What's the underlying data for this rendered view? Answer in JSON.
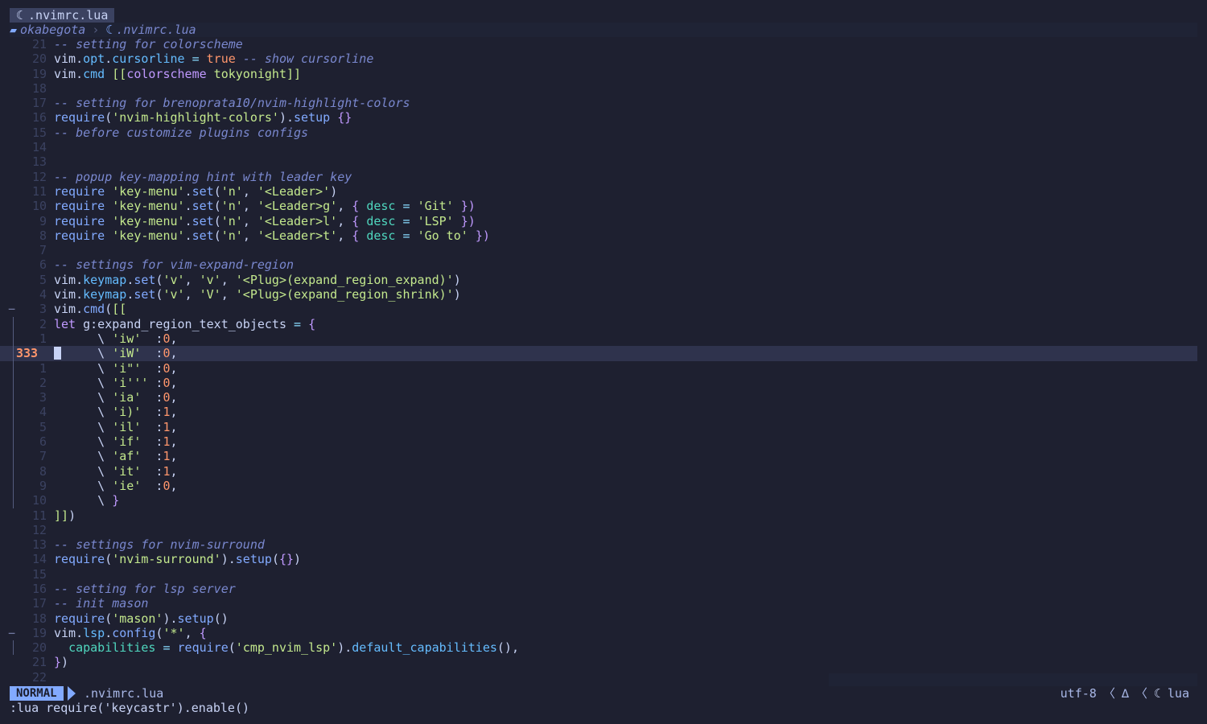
{
  "tab": {
    "icon": "lua-moon-icon",
    "title": ".nvimrc.lua"
  },
  "winbar": {
    "folder": "okabegota",
    "separator": "›",
    "file": ".nvimrc.lua"
  },
  "lines": [
    {
      "num": "21",
      "fold": "",
      "segs": [
        [
          "c",
          "-- setting for colorscheme"
        ]
      ]
    },
    {
      "num": "20",
      "fold": "",
      "segs": [
        [
          "v",
          "vim"
        ],
        [
          "v",
          "."
        ],
        [
          "p",
          "opt"
        ],
        [
          "v",
          "."
        ],
        [
          "p",
          "cursorline"
        ],
        [
          "v",
          " "
        ],
        [
          "o",
          "="
        ],
        [
          "v",
          " "
        ],
        [
          "b",
          "true"
        ],
        [
          "v",
          " "
        ],
        [
          "c",
          "-- show cursorline"
        ]
      ]
    },
    {
      "num": "19",
      "fold": "",
      "segs": [
        [
          "v",
          "vim"
        ],
        [
          "v",
          "."
        ],
        [
          "p",
          "cmd"
        ],
        [
          "v",
          " "
        ],
        [
          "s",
          "[["
        ],
        [
          "k",
          "colorscheme"
        ],
        [
          "s",
          " tokyonight]]"
        ]
      ]
    },
    {
      "num": "18",
      "fold": "",
      "segs": []
    },
    {
      "num": "17",
      "fold": "",
      "segs": [
        [
          "c",
          "-- setting for brenoprata10/nvim-highlight-colors"
        ]
      ]
    },
    {
      "num": "16",
      "fold": "",
      "segs": [
        [
          "f",
          "require"
        ],
        [
          "v",
          "("
        ],
        [
          "s",
          "'nvim-highlight-colors'"
        ],
        [
          "v",
          ")."
        ],
        [
          "f",
          "setup"
        ],
        [
          "v",
          " "
        ],
        [
          "k",
          "{}"
        ]
      ]
    },
    {
      "num": "15",
      "fold": "",
      "segs": [
        [
          "c",
          "-- before customize plugins configs"
        ]
      ]
    },
    {
      "num": "14",
      "fold": "",
      "segs": []
    },
    {
      "num": "13",
      "fold": "",
      "segs": []
    },
    {
      "num": "12",
      "fold": "",
      "segs": [
        [
          "c",
          "-- popup key-mapping hint with leader key"
        ]
      ]
    },
    {
      "num": "11",
      "fold": "",
      "segs": [
        [
          "f",
          "require"
        ],
        [
          "v",
          " "
        ],
        [
          "s",
          "'key-menu'"
        ],
        [
          "v",
          "."
        ],
        [
          "f",
          "set"
        ],
        [
          "v",
          "("
        ],
        [
          "s",
          "'n'"
        ],
        [
          "v",
          ", "
        ],
        [
          "s",
          "'<Leader>'"
        ],
        [
          "v",
          ")"
        ]
      ]
    },
    {
      "num": "10",
      "fold": "",
      "segs": [
        [
          "f",
          "require"
        ],
        [
          "v",
          " "
        ],
        [
          "s",
          "'key-menu'"
        ],
        [
          "v",
          "."
        ],
        [
          "f",
          "set"
        ],
        [
          "v",
          "("
        ],
        [
          "s",
          "'n'"
        ],
        [
          "v",
          ", "
        ],
        [
          "s",
          "'<Leader>g'"
        ],
        [
          "v",
          ", "
        ],
        [
          "k",
          "{"
        ],
        [
          "v",
          " "
        ],
        [
          "t",
          "desc"
        ],
        [
          "v",
          " "
        ],
        [
          "o",
          "="
        ],
        [
          "v",
          " "
        ],
        [
          "s",
          "'Git'"
        ],
        [
          "v",
          " "
        ],
        [
          "k",
          "})"
        ]
      ]
    },
    {
      "num": "9",
      "fold": "",
      "segs": [
        [
          "f",
          "require"
        ],
        [
          "v",
          " "
        ],
        [
          "s",
          "'key-menu'"
        ],
        [
          "v",
          "."
        ],
        [
          "f",
          "set"
        ],
        [
          "v",
          "("
        ],
        [
          "s",
          "'n'"
        ],
        [
          "v",
          ", "
        ],
        [
          "s",
          "'<Leader>l'"
        ],
        [
          "v",
          ", "
        ],
        [
          "k",
          "{"
        ],
        [
          "v",
          " "
        ],
        [
          "t",
          "desc"
        ],
        [
          "v",
          " "
        ],
        [
          "o",
          "="
        ],
        [
          "v",
          " "
        ],
        [
          "s",
          "'LSP'"
        ],
        [
          "v",
          " "
        ],
        [
          "k",
          "})"
        ]
      ]
    },
    {
      "num": "8",
      "fold": "",
      "segs": [
        [
          "f",
          "require"
        ],
        [
          "v",
          " "
        ],
        [
          "s",
          "'key-menu'"
        ],
        [
          "v",
          "."
        ],
        [
          "f",
          "set"
        ],
        [
          "v",
          "("
        ],
        [
          "s",
          "'n'"
        ],
        [
          "v",
          ", "
        ],
        [
          "s",
          "'<Leader>t'"
        ],
        [
          "v",
          ", "
        ],
        [
          "k",
          "{"
        ],
        [
          "v",
          " "
        ],
        [
          "t",
          "desc"
        ],
        [
          "v",
          " "
        ],
        [
          "o",
          "="
        ],
        [
          "v",
          " "
        ],
        [
          "s",
          "'Go to'"
        ],
        [
          "v",
          " "
        ],
        [
          "k",
          "})"
        ]
      ]
    },
    {
      "num": "7",
      "fold": "",
      "segs": []
    },
    {
      "num": "6",
      "fold": "",
      "segs": [
        [
          "c",
          "-- settings for vim-expand-region"
        ]
      ]
    },
    {
      "num": "5",
      "fold": "",
      "segs": [
        [
          "v",
          "vim"
        ],
        [
          "v",
          "."
        ],
        [
          "p",
          "keymap"
        ],
        [
          "v",
          "."
        ],
        [
          "f",
          "set"
        ],
        [
          "v",
          "("
        ],
        [
          "s",
          "'v'"
        ],
        [
          "v",
          ", "
        ],
        [
          "s",
          "'v'"
        ],
        [
          "v",
          ", "
        ],
        [
          "s",
          "'<Plug>(expand_region_expand)'"
        ],
        [
          "v",
          ")"
        ]
      ]
    },
    {
      "num": "4",
      "fold": "",
      "segs": [
        [
          "v",
          "vim"
        ],
        [
          "v",
          "."
        ],
        [
          "p",
          "keymap"
        ],
        [
          "v",
          "."
        ],
        [
          "f",
          "set"
        ],
        [
          "v",
          "("
        ],
        [
          "s",
          "'v'"
        ],
        [
          "v",
          ", "
        ],
        [
          "s",
          "'V'"
        ],
        [
          "v",
          ", "
        ],
        [
          "s",
          "'<Plug>(expand_region_shrink)'"
        ],
        [
          "v",
          ")"
        ]
      ]
    },
    {
      "num": "3",
      "fold": "−",
      "segs": [
        [
          "v",
          "vim"
        ],
        [
          "v",
          "."
        ],
        [
          "f",
          "cmd"
        ],
        [
          "v",
          "("
        ],
        [
          "s",
          "[["
        ]
      ]
    },
    {
      "num": "2",
      "fold": "bar",
      "segs": [
        [
          "k",
          "let"
        ],
        [
          "v",
          " g:expand_region_text_objects "
        ],
        [
          "o",
          "="
        ],
        [
          "v",
          " "
        ],
        [
          "k",
          "{"
        ]
      ]
    },
    {
      "num": "1",
      "fold": "bar",
      "segs": [
        [
          "v",
          "      \\ "
        ],
        [
          "s",
          "'iw'"
        ],
        [
          "v",
          "  :"
        ],
        [
          "b",
          "0"
        ],
        [
          "v",
          ","
        ]
      ]
    },
    {
      "num": "333",
      "fold": "bar",
      "cur": true,
      "segs": [
        [
          "v",
          "      \\ "
        ],
        [
          "s",
          "'iW'"
        ],
        [
          "v",
          "  :"
        ],
        [
          "b",
          "0"
        ],
        [
          "v",
          ","
        ]
      ]
    },
    {
      "num": "1",
      "fold": "bar",
      "segs": [
        [
          "v",
          "      \\ "
        ],
        [
          "s",
          "'i\"'"
        ],
        [
          "v",
          "  :"
        ],
        [
          "b",
          "0"
        ],
        [
          "v",
          ","
        ]
      ]
    },
    {
      "num": "2",
      "fold": "bar",
      "segs": [
        [
          "v",
          "      \\ "
        ],
        [
          "s",
          "'i'''"
        ],
        [
          "v",
          " :"
        ],
        [
          "b",
          "0"
        ],
        [
          "v",
          ","
        ]
      ]
    },
    {
      "num": "3",
      "fold": "bar",
      "segs": [
        [
          "v",
          "      \\ "
        ],
        [
          "s",
          "'ia'"
        ],
        [
          "v",
          "  :"
        ],
        [
          "b",
          "0"
        ],
        [
          "v",
          ","
        ]
      ]
    },
    {
      "num": "4",
      "fold": "bar",
      "segs": [
        [
          "v",
          "      \\ "
        ],
        [
          "s",
          "'i)'"
        ],
        [
          "v",
          "  :"
        ],
        [
          "b",
          "1"
        ],
        [
          "v",
          ","
        ]
      ]
    },
    {
      "num": "5",
      "fold": "bar",
      "segs": [
        [
          "v",
          "      \\ "
        ],
        [
          "s",
          "'il'"
        ],
        [
          "v",
          "  :"
        ],
        [
          "b",
          "1"
        ],
        [
          "v",
          ","
        ]
      ]
    },
    {
      "num": "6",
      "fold": "bar",
      "segs": [
        [
          "v",
          "      \\ "
        ],
        [
          "s",
          "'if'"
        ],
        [
          "v",
          "  :"
        ],
        [
          "b",
          "1"
        ],
        [
          "v",
          ","
        ]
      ]
    },
    {
      "num": "7",
      "fold": "bar",
      "segs": [
        [
          "v",
          "      \\ "
        ],
        [
          "s",
          "'af'"
        ],
        [
          "v",
          "  :"
        ],
        [
          "b",
          "1"
        ],
        [
          "v",
          ","
        ]
      ]
    },
    {
      "num": "8",
      "fold": "bar",
      "segs": [
        [
          "v",
          "      \\ "
        ],
        [
          "s",
          "'it'"
        ],
        [
          "v",
          "  :"
        ],
        [
          "b",
          "1"
        ],
        [
          "v",
          ","
        ]
      ]
    },
    {
      "num": "9",
      "fold": "bar",
      "segs": [
        [
          "v",
          "      \\ "
        ],
        [
          "s",
          "'ie'"
        ],
        [
          "v",
          "  :"
        ],
        [
          "b",
          "0"
        ],
        [
          "v",
          ","
        ]
      ]
    },
    {
      "num": "10",
      "fold": "bar",
      "segs": [
        [
          "v",
          "      \\ "
        ],
        [
          "k",
          "}"
        ]
      ]
    },
    {
      "num": "11",
      "fold": "",
      "segs": [
        [
          "s",
          "]]"
        ],
        [
          "v",
          ")"
        ]
      ]
    },
    {
      "num": "12",
      "fold": "",
      "segs": []
    },
    {
      "num": "13",
      "fold": "",
      "segs": [
        [
          "c",
          "-- settings for nvim-surround"
        ]
      ]
    },
    {
      "num": "14",
      "fold": "",
      "segs": [
        [
          "f",
          "require"
        ],
        [
          "v",
          "("
        ],
        [
          "s",
          "'nvim-surround'"
        ],
        [
          "v",
          ")."
        ],
        [
          "f",
          "setup"
        ],
        [
          "v",
          "("
        ],
        [
          "k",
          "{}"
        ],
        [
          "v",
          ")"
        ]
      ]
    },
    {
      "num": "15",
      "fold": "",
      "segs": []
    },
    {
      "num": "16",
      "fold": "",
      "segs": [
        [
          "c",
          "-- setting for lsp server"
        ]
      ]
    },
    {
      "num": "17",
      "fold": "",
      "segs": [
        [
          "c",
          "-- init mason"
        ]
      ]
    },
    {
      "num": "18",
      "fold": "",
      "segs": [
        [
          "f",
          "require"
        ],
        [
          "v",
          "("
        ],
        [
          "s",
          "'mason'"
        ],
        [
          "v",
          ")."
        ],
        [
          "f",
          "setup"
        ],
        [
          "v",
          "()"
        ]
      ]
    },
    {
      "num": "19",
      "fold": "−",
      "segs": [
        [
          "v",
          "vim"
        ],
        [
          "v",
          "."
        ],
        [
          "p",
          "lsp"
        ],
        [
          "v",
          "."
        ],
        [
          "f",
          "config"
        ],
        [
          "v",
          "("
        ],
        [
          "s",
          "'*'"
        ],
        [
          "v",
          ", "
        ],
        [
          "k",
          "{"
        ]
      ]
    },
    {
      "num": "20",
      "fold": "bar",
      "segs": [
        [
          "v",
          "  "
        ],
        [
          "t",
          "capabilities"
        ],
        [
          "v",
          " "
        ],
        [
          "o",
          "="
        ],
        [
          "v",
          " "
        ],
        [
          "f",
          "require"
        ],
        [
          "v",
          "("
        ],
        [
          "s",
          "'cmp_nvim_lsp'"
        ],
        [
          "v",
          ")."
        ],
        [
          "p",
          "default_capabilities"
        ],
        [
          "v",
          "(),"
        ]
      ]
    },
    {
      "num": "21",
      "fold": "",
      "segs": [
        [
          "k",
          "}"
        ],
        [
          "v",
          ")"
        ]
      ]
    },
    {
      "num": "22",
      "fold": "",
      "segs": []
    }
  ],
  "statusline": {
    "mode": "NORMAL",
    "file": ".nvimrc.lua",
    "encoding": "utf-8",
    "sep": "〈",
    "fileformat": "∆",
    "filetype": "lua",
    "filetype_icon": "lua-moon-icon"
  },
  "cmdline": ":lua require('keycastr').enable()",
  "colors": {
    "background": "#1e2030",
    "cursorline": "#2f334d",
    "mode_bg": "#82aaff",
    "string": "#c3e88d",
    "number": "#ff966c",
    "comment": "#7a88cf"
  }
}
